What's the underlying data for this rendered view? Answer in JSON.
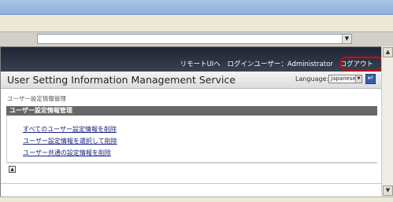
{
  "header": {
    "remote_ui": "リモートUIへ",
    "login_user": "ログインユーザー：Administrator",
    "logout": "ログアウト"
  },
  "service_title": "User Setting Information Management Service",
  "language": {
    "label": "Language:",
    "value": "Japanese",
    "apply_icon": "enter-arrow-icon"
  },
  "breadcrumb": "ユーザー設定情報管理",
  "section": {
    "title": "ユーザー設定情報管理",
    "links": [
      "すべてのユーザー設定情報を削除",
      "ユーザー設定情報を選択して削除",
      "ユーザー共通の設定情報を削除"
    ]
  },
  "colors": {
    "highlight_ring": "#e00000",
    "header_dark": "#2e3545",
    "section_bar": "#676767",
    "link": "#1a237e"
  }
}
